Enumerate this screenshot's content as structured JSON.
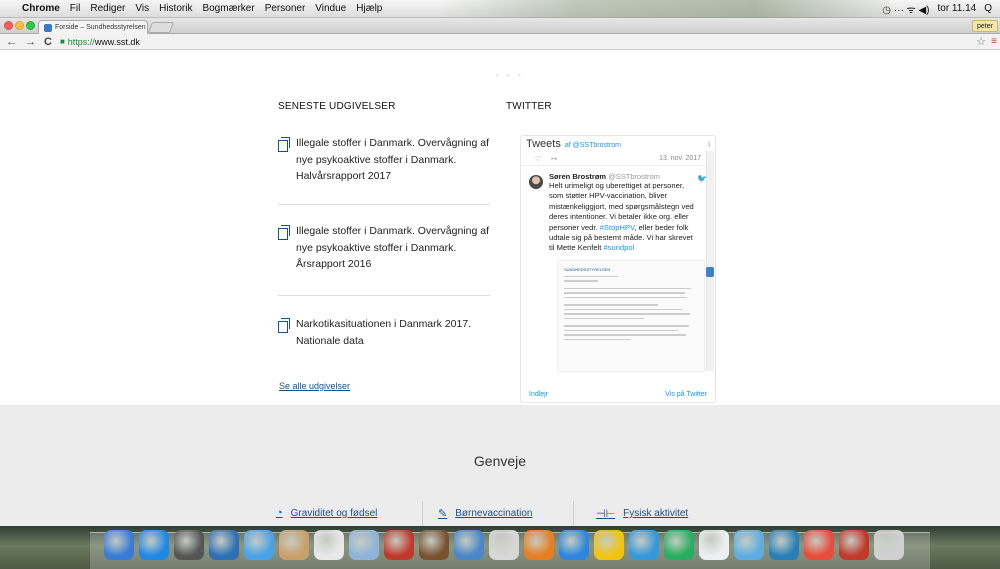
{
  "menubar": {
    "app": "Chrome",
    "items": [
      "Fil",
      "Rediger",
      "Vis",
      "Historik",
      "Bogmærker",
      "Personer",
      "Vindue",
      "Hjælp"
    ],
    "clock": "tor 11.14",
    "status_glyphs": "◷ ··· ᯤ ◀)"
  },
  "browser": {
    "tab_title": "Forside – Sundhedsstyrelsen",
    "tab_close": "×",
    "profile": "peter",
    "url_scheme": "https://",
    "url_host": "www.sst.dk",
    "back": "←",
    "forward": "→",
    "reload": "C",
    "star": "☆",
    "menu": "≡"
  },
  "page": {
    "dots": "• • •",
    "publications_heading": "SENESTE UDGIVELSER",
    "twitter_heading": "TWITTER",
    "publications": [
      {
        "title": "Illegale stoffer i Danmark. Overvågning af nye psykoaktive stoffer i Danmark. Halvårsrapport 2017"
      },
      {
        "title": "Illegale stoffer i Danmark. Overvågning af nye psykoaktive stoffer i Danmark. Årsrapport 2016"
      },
      {
        "title": "Narkotikasituationen i Danmark 2017. Nationale data"
      }
    ],
    "see_all": "Se alle udgivelser"
  },
  "twitter": {
    "title": "Tweets",
    "by": "af @SSTbrostrom",
    "info": "i",
    "prev_date": "13. nov. 2017",
    "prev_like": "♡",
    "prev_share": "↦",
    "author_name": "Søren Brostrøm",
    "author_handle": "@SSTbrostrom",
    "bird": "🐦",
    "tweet_pre": "Helt urimeligt og uberettiget at personer, som støtter HPV-vaccination, bliver mistænkeliggjort, med spørgsmålstegn ved deres intentioner. Vi betaler ikke org. eller personer vedr.",
    "tweet_tag1": "#StopHPV",
    "tweet_mid": ", eller beder folk udtale sig på bestemt måde. Vi har skrevet til Mette Kenfelt",
    "tweet_tag2": "#sundpol",
    "letter_logo": "SUNDHEDSSTYRELSEN",
    "embed": "Indlejr",
    "view_on": "Vis på Twitter"
  },
  "footer": {
    "title": "Genveje",
    "shortcuts": [
      {
        "label": "Graviditet og fødsel",
        "icon": "pregnancy-icon",
        "glyph": "◔"
      },
      {
        "label": "Børnevaccination",
        "icon": "syringe-icon",
        "glyph": "✎"
      },
      {
        "label": "Fysisk aktivitet",
        "icon": "dumbbell-icon",
        "glyph": "⊣⊢"
      }
    ]
  },
  "dock": {
    "colors": [
      "#3a7bd5",
      "#1e88e5",
      "#555555",
      "#2e6fb5",
      "#4aa3e8",
      "#c9a06a",
      "#e8e8e8",
      "#8fb3d9",
      "#c0392b",
      "#7a5230",
      "#4a86c8",
      "#d7d7d7",
      "#e67e22",
      "#2e86de",
      "#f1c40f",
      "#3498db",
      "#27ae60",
      "#ecf0f1",
      "#5dade2",
      "#2980b9",
      "#e74c3c",
      "#c0392b",
      "#d0d0d0"
    ]
  }
}
